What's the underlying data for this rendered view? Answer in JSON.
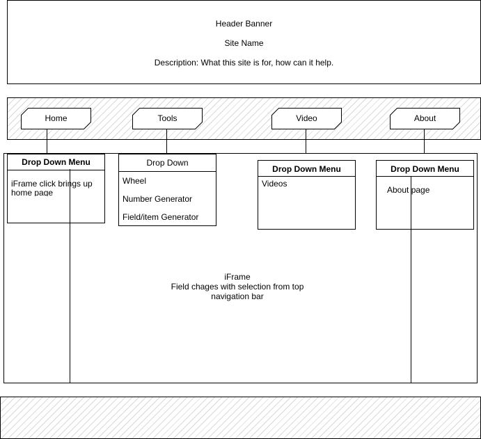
{
  "header": {
    "title": "Header Banner",
    "site_name": "Site Name",
    "description": "Description: What this site is for, how can it help."
  },
  "nav": {
    "tabs": [
      {
        "label": "Home"
      },
      {
        "label": "Tools"
      },
      {
        "label": "Video"
      },
      {
        "label": "About"
      }
    ]
  },
  "dropdowns": {
    "home": {
      "title": "Drop Down Menu",
      "text": "iFrame click brings up home page"
    },
    "tools": {
      "title": "Drop Down",
      "items": [
        "Wheel",
        "Number Generator",
        "Field/item Generator"
      ]
    },
    "video": {
      "title": "Drop Down Menu",
      "items": [
        "Videos"
      ]
    },
    "about": {
      "title": "Drop Down Menu",
      "items": [
        "About page"
      ]
    }
  },
  "iframe": {
    "title": "iFrame",
    "caption": "Field chages with selection from top navigation bar"
  }
}
